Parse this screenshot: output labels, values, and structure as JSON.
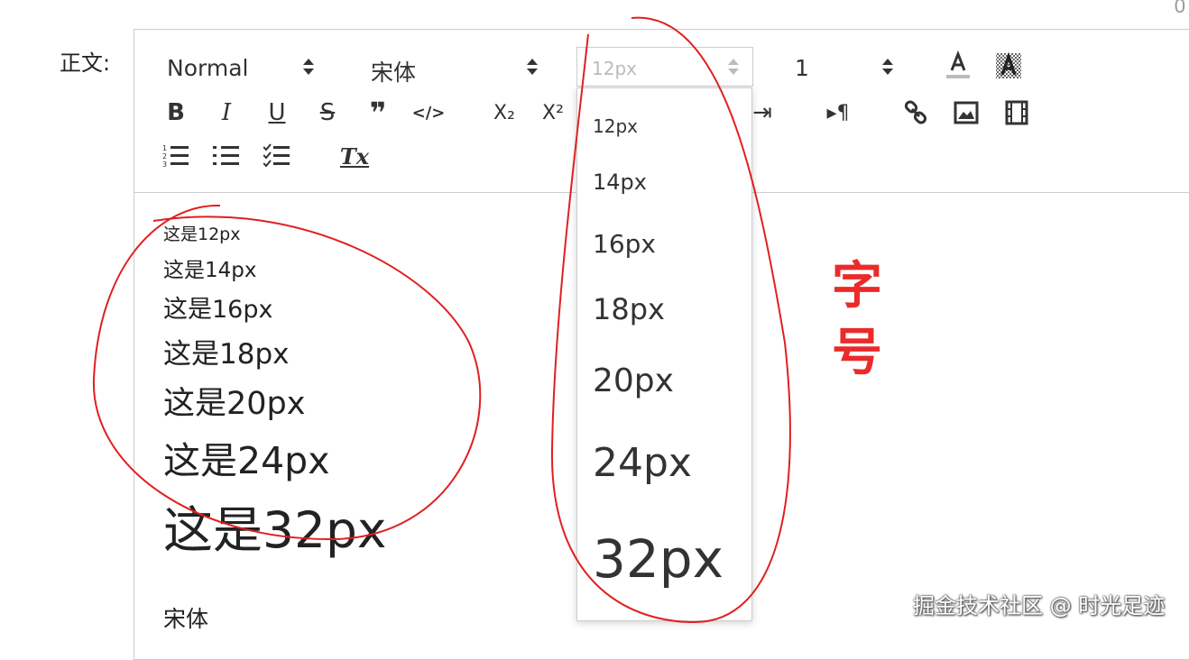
{
  "counter": "0",
  "field_label": "正文:",
  "toolbar": {
    "header_picker": "Normal",
    "font_picker": "宋体",
    "size_picker": "12px",
    "line_height_picker": "1",
    "buttons": {
      "bold": "B",
      "italic": "I",
      "underline": "U",
      "strike": "S",
      "blockquote": "❞",
      "code": "</>",
      "subscript": "X₂",
      "superscript": "X²",
      "indent": "⇥",
      "direction": "▸¶",
      "clean": "Tx"
    }
  },
  "size_dropdown": {
    "options": [
      "12px",
      "14px",
      "16px",
      "18px",
      "20px",
      "24px",
      "32px"
    ]
  },
  "content": {
    "lines": [
      "这是12px",
      "这是14px",
      "这是16px",
      "这是18px",
      "这是20px",
      "这是24px",
      "这是32px",
      "宋体"
    ]
  },
  "annotation": {
    "char1": "字",
    "char2": "号"
  },
  "watermark": "掘金技术社区 @ 时光足迹",
  "colors": {
    "annotation": "#ea2b2b",
    "border": "#cccccc",
    "text": "#333333"
  }
}
